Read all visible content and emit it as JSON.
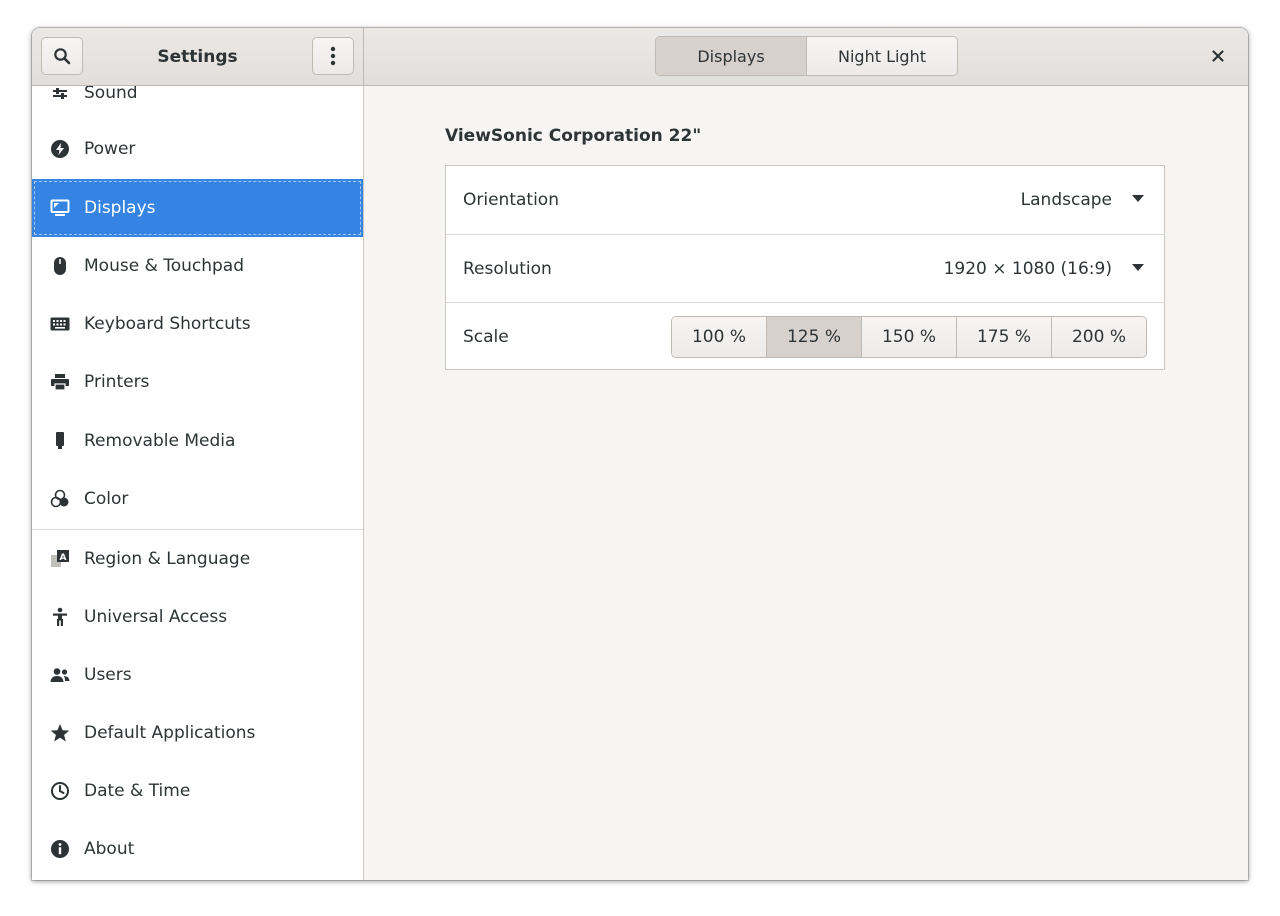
{
  "header": {
    "title": "Settings",
    "search_icon": "search-icon",
    "menu_icon": "vertical-dots-icon",
    "close_icon": "close-icon",
    "tabs": [
      {
        "label": "Displays",
        "active": true
      },
      {
        "label": "Night Light",
        "active": false
      }
    ]
  },
  "sidebar": {
    "items": [
      {
        "label": "Sound",
        "icon": "sound-sliders-icon"
      },
      {
        "label": "Power",
        "icon": "power-icon"
      },
      {
        "label": "Displays",
        "icon": "display-icon",
        "selected": true
      },
      {
        "label": "Mouse & Touchpad",
        "icon": "mouse-icon"
      },
      {
        "label": "Keyboard Shortcuts",
        "icon": "keyboard-icon"
      },
      {
        "label": "Printers",
        "icon": "printer-icon"
      },
      {
        "label": "Removable Media",
        "icon": "usb-drive-icon"
      },
      {
        "label": "Color",
        "icon": "color-icon"
      },
      {
        "label": "Region & Language",
        "icon": "region-language-icon"
      },
      {
        "label": "Universal Access",
        "icon": "accessibility-icon"
      },
      {
        "label": "Users",
        "icon": "users-icon"
      },
      {
        "label": "Default Applications",
        "icon": "star-icon"
      },
      {
        "label": "Date & Time",
        "icon": "clock-icon"
      },
      {
        "label": "About",
        "icon": "info-icon"
      }
    ]
  },
  "display": {
    "monitor_name": "ViewSonic Corporation 22\"",
    "orientation": {
      "label": "Orientation",
      "value": "Landscape"
    },
    "resolution": {
      "label": "Resolution",
      "value": "1920 × 1080 (16:9)"
    },
    "scale": {
      "label": "Scale",
      "options": [
        "100 %",
        "125 %",
        "150 %",
        "175 %",
        "200 %"
      ],
      "selected": "125 %"
    }
  },
  "colors": {
    "accent": "#3584e4",
    "header_bg": "#e5e2df",
    "window_bg": "#f6f5f4"
  }
}
